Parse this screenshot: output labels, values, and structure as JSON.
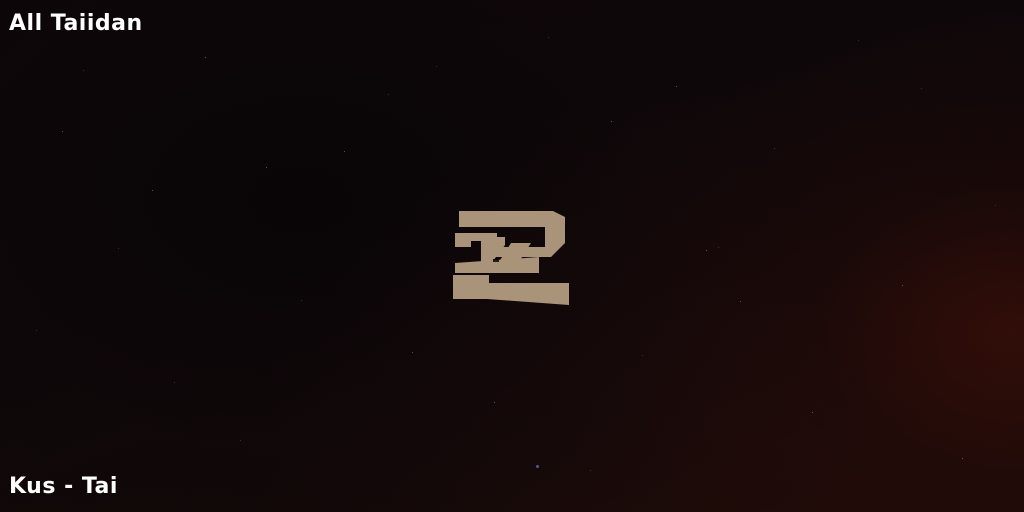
{
  "top_label": "All Taiidan",
  "bottom_label": "Kus - Tai",
  "emblem": {
    "icon": "faction-emblem-icon",
    "color": "#a9947a"
  },
  "colors": {
    "background": "#0c0608",
    "nebula_glow": "#3c0e07",
    "label_text": "#ffffff"
  }
}
